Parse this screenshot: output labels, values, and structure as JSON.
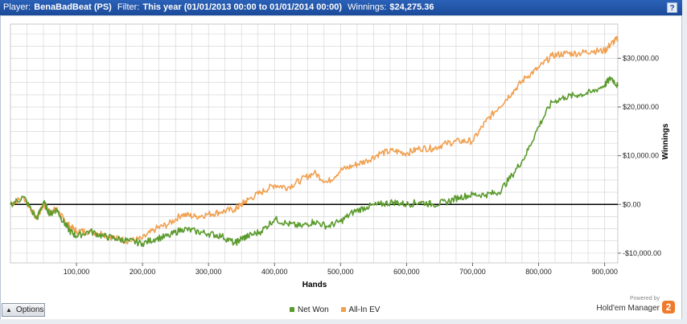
{
  "header": {
    "player_label": "Player:",
    "player_value": "BenaBadBeat (PS)",
    "filter_label": "Filter:",
    "filter_value": "This year (01/01/2013 00:00 to 01/01/2014 00:00)",
    "winnings_label": "Winnings:",
    "winnings_value": "$24,275.36",
    "help_label": "?"
  },
  "footer": {
    "options_label": "Options",
    "powered_by": "Powered by",
    "brand": "Hold'em Manager",
    "brand_badge": "2"
  },
  "colors": {
    "net_won": "#5a9a2c",
    "all_in_ev": "#f0a050",
    "zero_line": "#000000",
    "grid": "#d0d0d0"
  },
  "chart_data": {
    "type": "line",
    "xlabel": "Hands",
    "ylabel": "Winnings",
    "xlim": [
      0,
      920000
    ],
    "ylim": [
      -12000,
      37000
    ],
    "xticks": [
      100000,
      200000,
      300000,
      400000,
      500000,
      600000,
      700000,
      800000,
      900000
    ],
    "xtick_labels": [
      "100,000",
      "200,000",
      "300,000",
      "400,000",
      "500,000",
      "600,000",
      "700,000",
      "800,000",
      "900,000"
    ],
    "yticks": [
      -10000,
      0,
      10000,
      20000,
      30000
    ],
    "ytick_labels": [
      "-$10,000.00",
      "$0.00",
      "$10,000.00",
      "$20,000.00",
      "$30,000.00"
    ],
    "grid": true,
    "legend_position": "bottom-center",
    "series": [
      {
        "name": "Net Won",
        "x": [
          0,
          20000,
          40000,
          50000,
          60000,
          70000,
          80000,
          90000,
          100000,
          120000,
          140000,
          160000,
          180000,
          200000,
          220000,
          240000,
          260000,
          280000,
          300000,
          320000,
          340000,
          350000,
          360000,
          380000,
          400000,
          420000,
          440000,
          460000,
          480000,
          500000,
          520000,
          540000,
          560000,
          580000,
          600000,
          620000,
          640000,
          660000,
          680000,
          700000,
          720000,
          740000,
          760000,
          780000,
          800000,
          820000,
          840000,
          860000,
          880000,
          900000,
          910000,
          920000
        ],
        "y": [
          0,
          1500,
          -3000,
          500,
          -2000,
          -1000,
          -3500,
          -5500,
          -6500,
          -5500,
          -6500,
          -7000,
          -7500,
          -8000,
          -7000,
          -6500,
          -5000,
          -5500,
          -6000,
          -6500,
          -8000,
          -7000,
          -6500,
          -5500,
          -3000,
          -4000,
          -4500,
          -3500,
          -4500,
          -3500,
          -1500,
          -500,
          0,
          500,
          0,
          500,
          0,
          500,
          1500,
          2000,
          2000,
          2500,
          6000,
          10000,
          16000,
          21000,
          22000,
          22500,
          23000,
          24500,
          26000,
          24300
        ]
      },
      {
        "name": "All-In EV",
        "x": [
          0,
          20000,
          40000,
          50000,
          60000,
          70000,
          80000,
          90000,
          100000,
          120000,
          140000,
          160000,
          180000,
          200000,
          220000,
          240000,
          260000,
          280000,
          300000,
          320000,
          340000,
          350000,
          360000,
          380000,
          400000,
          420000,
          440000,
          460000,
          480000,
          500000,
          520000,
          540000,
          560000,
          580000,
          600000,
          620000,
          640000,
          660000,
          680000,
          700000,
          720000,
          740000,
          760000,
          780000,
          800000,
          820000,
          840000,
          860000,
          880000,
          900000,
          910000,
          920000
        ],
        "y": [
          0,
          1500,
          -3000,
          0,
          -1500,
          -1000,
          -3000,
          -4500,
          -5500,
          -5500,
          -6000,
          -7000,
          -7500,
          -7000,
          -5000,
          -4000,
          -2000,
          -2500,
          -2000,
          -1500,
          -1000,
          0,
          1000,
          2500,
          4000,
          3500,
          5000,
          6500,
          4500,
          7000,
          8000,
          9000,
          10500,
          11000,
          10500,
          11500,
          11500,
          12500,
          13000,
          13000,
          17000,
          20000,
          23000,
          26000,
          28000,
          30500,
          31000,
          31000,
          31500,
          31500,
          33000,
          34000
        ]
      }
    ]
  }
}
